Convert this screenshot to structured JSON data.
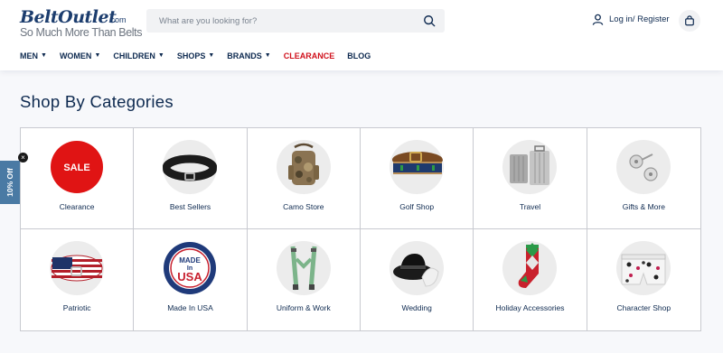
{
  "logo": {
    "main": "BeltOutlet",
    "dotcom": ".com",
    "tagline": "So Much More Than Belts"
  },
  "search": {
    "placeholder": "What are you looking for?"
  },
  "account": {
    "login_label": "Log in/ Register"
  },
  "nav": [
    {
      "label": "MEN",
      "has_dropdown": true
    },
    {
      "label": "WOMEN",
      "has_dropdown": true
    },
    {
      "label": "CHILDREN",
      "has_dropdown": true
    },
    {
      "label": "SHOPS",
      "has_dropdown": true
    },
    {
      "label": "BRANDS",
      "has_dropdown": true
    },
    {
      "label": "CLEARANCE",
      "has_dropdown": false,
      "color": "#d0101b"
    },
    {
      "label": "BLOG",
      "has_dropdown": false
    }
  ],
  "page": {
    "title": "Shop By Categories"
  },
  "categories": [
    {
      "label": "Clearance",
      "icon": "sale-badge-icon",
      "badge_text": "SALE"
    },
    {
      "label": "Best Sellers",
      "icon": "belt-icon"
    },
    {
      "label": "Camo Store",
      "icon": "camo-backpack-icon"
    },
    {
      "label": "Golf Shop",
      "icon": "golf-belt-icon"
    },
    {
      "label": "Travel",
      "icon": "luggage-icon"
    },
    {
      "label": "Gifts & More",
      "icon": "cufflinks-icon"
    },
    {
      "label": "Patriotic",
      "icon": "flag-belt-icon"
    },
    {
      "label": "Made In USA",
      "icon": "made-in-usa-badge-icon",
      "badge_lines": [
        "MADE",
        "In",
        "USA"
      ]
    },
    {
      "label": "Uniform & Work",
      "icon": "suspenders-icon"
    },
    {
      "label": "Wedding",
      "icon": "fedora-hat-icon"
    },
    {
      "label": "Holiday Accessories",
      "icon": "argyle-sock-icon"
    },
    {
      "label": "Character Shop",
      "icon": "patterned-boxers-icon"
    }
  ],
  "promo_tab": {
    "label": "10% Off",
    "close": "×"
  },
  "colors": {
    "navy": "#0e2a50",
    "clearance_red": "#d0101b",
    "promo_blue": "#4a7aa4"
  }
}
